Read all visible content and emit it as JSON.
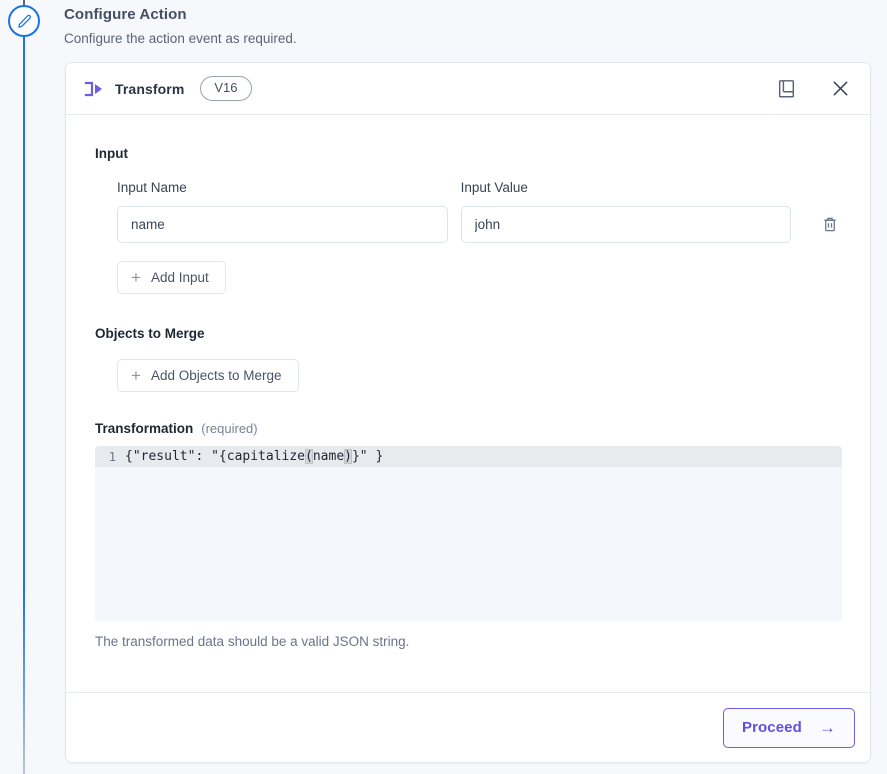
{
  "page": {
    "title": "Configure Action",
    "subtitle": "Configure the action event as required.",
    "step_icon": "pencil-icon"
  },
  "card": {
    "icon": "transform-icon",
    "title": "Transform",
    "version_badge": "V16",
    "actions": {
      "docs_icon": "book-icon",
      "close_icon": "close-icon"
    }
  },
  "input_section": {
    "label": "Input",
    "columns": {
      "name_label": "Input Name",
      "value_label": "Input Value"
    },
    "rows": [
      {
        "name_value": "name",
        "name_placeholder": "Input Name",
        "value_value": "john",
        "value_placeholder": "Input Value",
        "delete_icon": "trash-icon"
      }
    ],
    "add_button": {
      "label": "Add Input",
      "icon": "plus-icon"
    }
  },
  "merge_section": {
    "label": "Objects to Merge",
    "add_button": {
      "label": "Add Objects to Merge",
      "icon": "plus-icon"
    }
  },
  "transformation_section": {
    "label": "Transformation",
    "required_hint": "(required)",
    "editor": {
      "line_number": "1",
      "code_before": "{\"result\": \"{capitalize",
      "code_open_bracket": "(",
      "code_inner": "name",
      "code_close_bracket": ")",
      "code_after": "}\" }",
      "full_code": "{\"result\": \"{capitalize(name)}\" }"
    },
    "helper_text": "The transformed data should be a valid JSON string."
  },
  "footer": {
    "proceed_label": "Proceed",
    "proceed_arrow": "→",
    "accent_color": "#6050e0"
  },
  "colors": {
    "rail_active": "#1a73e8",
    "accent_purple": "#6c5ce7",
    "page_bg": "#f6f8fb",
    "editor_bg": "#f4f8fc"
  }
}
